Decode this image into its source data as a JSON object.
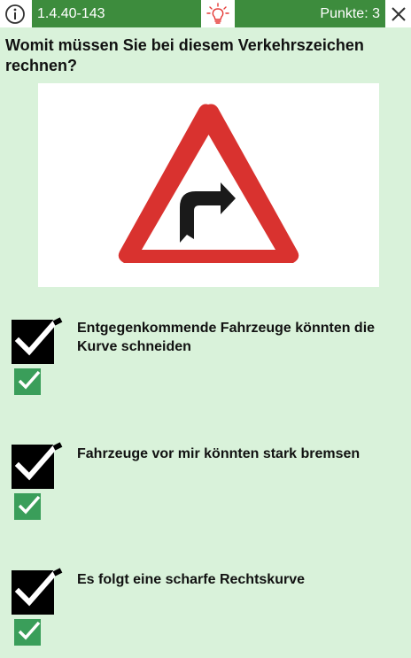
{
  "header": {
    "question_id": "1.4.40-143",
    "points": "Punkte: 3"
  },
  "question": {
    "text": "Womit müssen Sie bei diesem Verkehrszeichen rechnen?"
  },
  "answers": [
    {
      "text": "Entgegenkommende Fahrzeuge könnten die Kurve schneiden",
      "selected": true,
      "correct": true
    },
    {
      "text": "Fahrzeuge vor mir könnten stark bremsen",
      "selected": true,
      "correct": true
    },
    {
      "text": "Es folgt eine scharfe Rechtskurve",
      "selected": true,
      "correct": true
    }
  ],
  "colors": {
    "background": "#d9f2da",
    "header_green": "#3d8c3d",
    "correct_green": "#3a9e5a",
    "sign_red": "#d9322f",
    "hint_red": "#e53935"
  },
  "icons": {
    "info": "info-icon",
    "hint": "lightbulb-icon",
    "close": "close-icon",
    "selected": "checkbox-checked-icon",
    "correct": "correct-check-icon"
  }
}
